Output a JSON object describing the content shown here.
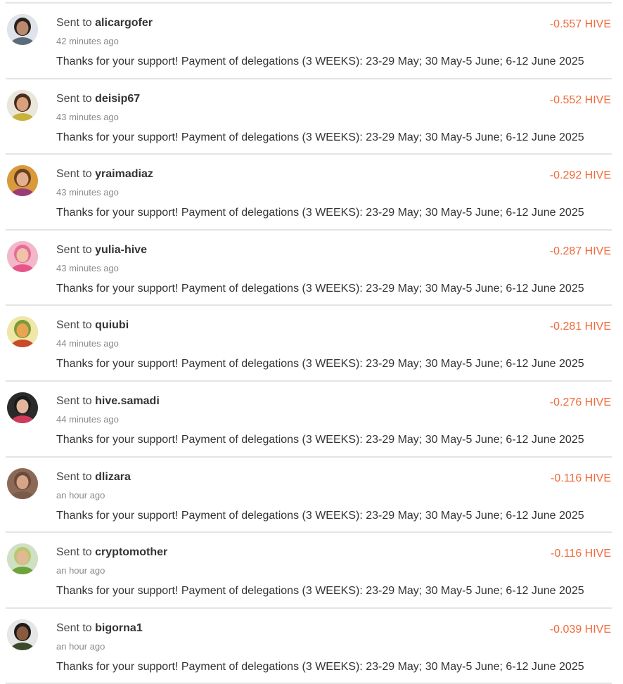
{
  "transfers": [
    {
      "prefix": "Sent to",
      "user": "alicargofer",
      "time": "42 minutes ago",
      "amount": "-0.557 HIVE",
      "memo": "Thanks for your support! Payment of delegations (3 WEEKS): 23-29 May; 30 May-5 June; 6-12 June 2025",
      "avatar": {
        "bg": "#dfe4ea",
        "skin": "#b98a6e",
        "hair": "#2b211c",
        "cloth": "#5c6b7a"
      }
    },
    {
      "prefix": "Sent to",
      "user": "deisip67",
      "time": "43 minutes ago",
      "amount": "-0.552 HIVE",
      "memo": "Thanks for your support! Payment of delegations (3 WEEKS): 23-29 May; 30 May-5 June; 6-12 June 2025",
      "avatar": {
        "bg": "#e9e6dc",
        "skin": "#d9a07c",
        "hair": "#4a2d1c",
        "cloth": "#c9b23a"
      }
    },
    {
      "prefix": "Sent to",
      "user": "yraimadiaz",
      "time": "43 minutes ago",
      "amount": "-0.292 HIVE",
      "memo": "Thanks for your support! Payment of delegations (3 WEEKS): 23-29 May; 30 May-5 June; 6-12 June 2025",
      "avatar": {
        "bg": "#d99a3a",
        "skin": "#e2b08e",
        "hair": "#6b3f22",
        "cloth": "#9b3c7a"
      }
    },
    {
      "prefix": "Sent to",
      "user": "yulia-hive",
      "time": "43 minutes ago",
      "amount": "-0.287 HIVE",
      "memo": "Thanks for your support! Payment of delegations (3 WEEKS): 23-29 May; 30 May-5 June; 6-12 June 2025",
      "avatar": {
        "bg": "#f3b8c8",
        "skin": "#efc3a8",
        "hair": "#e86a9a",
        "cloth": "#e8558a"
      }
    },
    {
      "prefix": "Sent to",
      "user": "quiubi",
      "time": "44 minutes ago",
      "amount": "-0.281 HIVE",
      "memo": "Thanks for your support! Payment of delegations (3 WEEKS): 23-29 May; 30 May-5 June; 6-12 June 2025",
      "avatar": {
        "bg": "#f0e6a6",
        "skin": "#e9a451",
        "hair": "#7c9a3a",
        "cloth": "#c94a2a"
      }
    },
    {
      "prefix": "Sent to",
      "user": "hive.samadi",
      "time": "44 minutes ago",
      "amount": "-0.276 HIVE",
      "memo": "Thanks for your support! Payment of delegations (3 WEEKS): 23-29 May; 30 May-5 June; 6-12 June 2025",
      "avatar": {
        "bg": "#2a2a2a",
        "skin": "#e3b59a",
        "hair": "#1a1a1a",
        "cloth": "#d23a5a"
      }
    },
    {
      "prefix": "Sent to",
      "user": "dlizara",
      "time": "an hour ago",
      "amount": "-0.116 HIVE",
      "memo": "Thanks for your support! Payment of delegations (3 WEEKS): 23-29 May; 30 May-5 June; 6-12 June 2025",
      "avatar": {
        "bg": "#8a6a56",
        "skin": "#d6a488",
        "hair": "#6a4a3a",
        "cloth": "#7a5b4a"
      }
    },
    {
      "prefix": "Sent to",
      "user": "cryptomother",
      "time": "an hour ago",
      "amount": "-0.116 HIVE",
      "memo": "Thanks for your support! Payment of delegations (3 WEEKS): 23-29 May; 30 May-5 June; 6-12 June 2025",
      "avatar": {
        "bg": "#cfe0c4",
        "skin": "#e1b994",
        "hair": "#b8c86a",
        "cloth": "#6ea23a"
      }
    },
    {
      "prefix": "Sent to",
      "user": "bigorna1",
      "time": "an hour ago",
      "amount": "-0.039 HIVE",
      "memo": "Thanks for your support! Payment of delegations (3 WEEKS): 23-29 May; 30 May-5 June; 6-12 June 2025",
      "avatar": {
        "bg": "#e6e6e6",
        "skin": "#8a5a3e",
        "hair": "#1c1c1c",
        "cloth": "#3a4a2a"
      }
    }
  ]
}
